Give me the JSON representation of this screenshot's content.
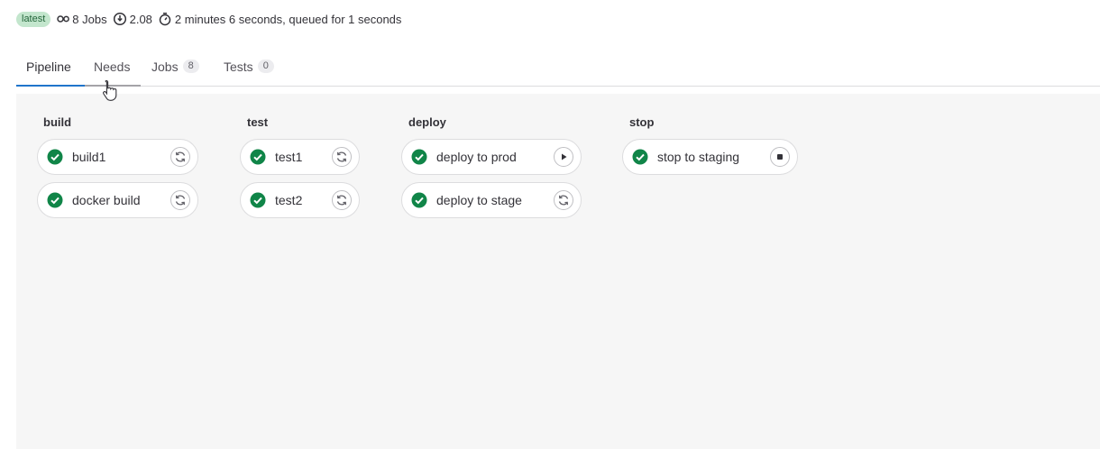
{
  "meta": {
    "badge": "latest",
    "jobs_text": "8 Jobs",
    "duration_text": "2.08",
    "timing_text": "2 minutes 6 seconds, queued for 1 seconds"
  },
  "tabs": [
    {
      "label": "Pipeline",
      "active": true
    },
    {
      "label": "Needs",
      "active": false
    },
    {
      "label": "Jobs",
      "count": "8",
      "active": false
    },
    {
      "label": "Tests",
      "count": "0",
      "active": false
    }
  ],
  "stages": [
    {
      "title": "build",
      "jobs": [
        {
          "name": "build1",
          "status": "passed",
          "action": "retry-icon"
        },
        {
          "name": "docker build",
          "status": "passed",
          "action": "retry-icon"
        }
      ]
    },
    {
      "title": "test",
      "jobs": [
        {
          "name": "test1",
          "status": "passed",
          "action": "retry-icon"
        },
        {
          "name": "test2",
          "status": "passed",
          "action": "retry-icon"
        }
      ]
    },
    {
      "title": "deploy",
      "jobs": [
        {
          "name": "deploy to prod",
          "status": "passed",
          "action": "play-icon"
        },
        {
          "name": "deploy to stage",
          "status": "passed",
          "action": "retry-icon"
        }
      ]
    },
    {
      "title": "stop",
      "jobs": [
        {
          "name": "stop to staging",
          "status": "passed",
          "action": "stop-icon"
        }
      ]
    }
  ],
  "colors": {
    "success": "#108548",
    "active_tab": "#1f75cb",
    "graph_bg": "#f6f6f6"
  }
}
